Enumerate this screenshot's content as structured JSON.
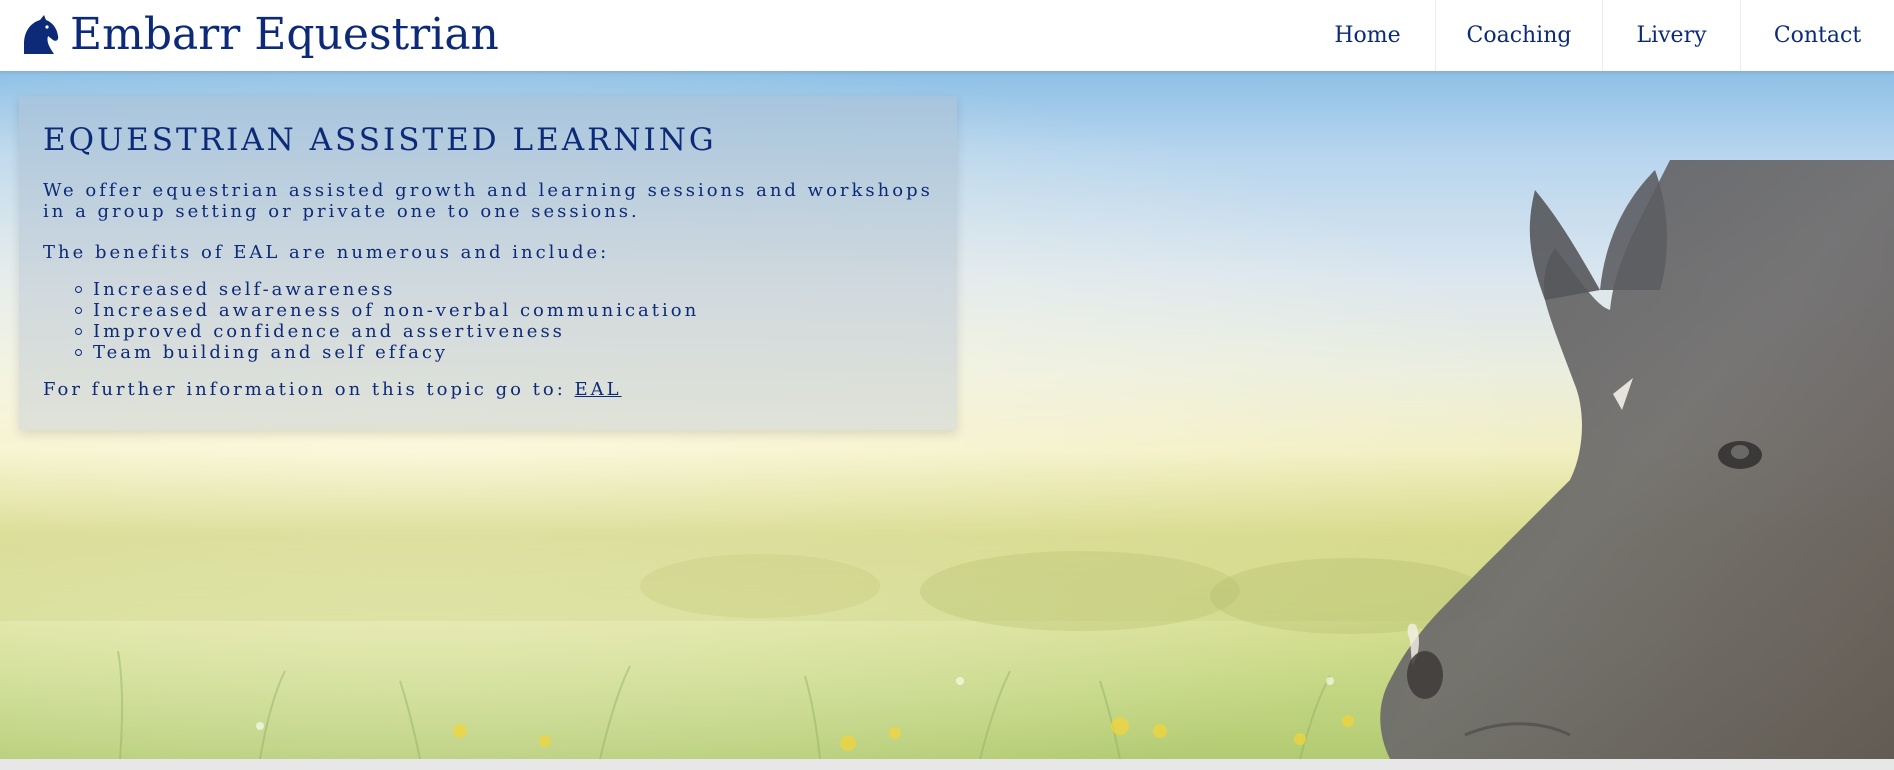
{
  "header": {
    "brand_name": "Embarr Equestrian",
    "logo_icon": "horse-head-icon",
    "nav": [
      {
        "label": "Home"
      },
      {
        "label": "Coaching"
      },
      {
        "label": "Livery"
      },
      {
        "label": "Contact"
      }
    ]
  },
  "card": {
    "title": "EQUESTRIAN ASSISTED LEARNING",
    "intro": "We offer equestrian assisted growth and learning sessions and workshops in a group setting or private one to one sessions.",
    "benefits_intro": "The benefits of EAL are numerous and include:",
    "benefits": [
      "Increased self-awareness",
      "Increased awareness of non-verbal communication",
      "Improved confidence and assertiveness",
      "Team building and self effacy"
    ],
    "footer_prefix": "For further information on this topic go to:",
    "footer_link": "EAL"
  },
  "colors": {
    "brand": "#0d2a78",
    "header_bg": "#ffffff",
    "sky_top": "#8dc0e6",
    "meadow": "#c3d682"
  }
}
